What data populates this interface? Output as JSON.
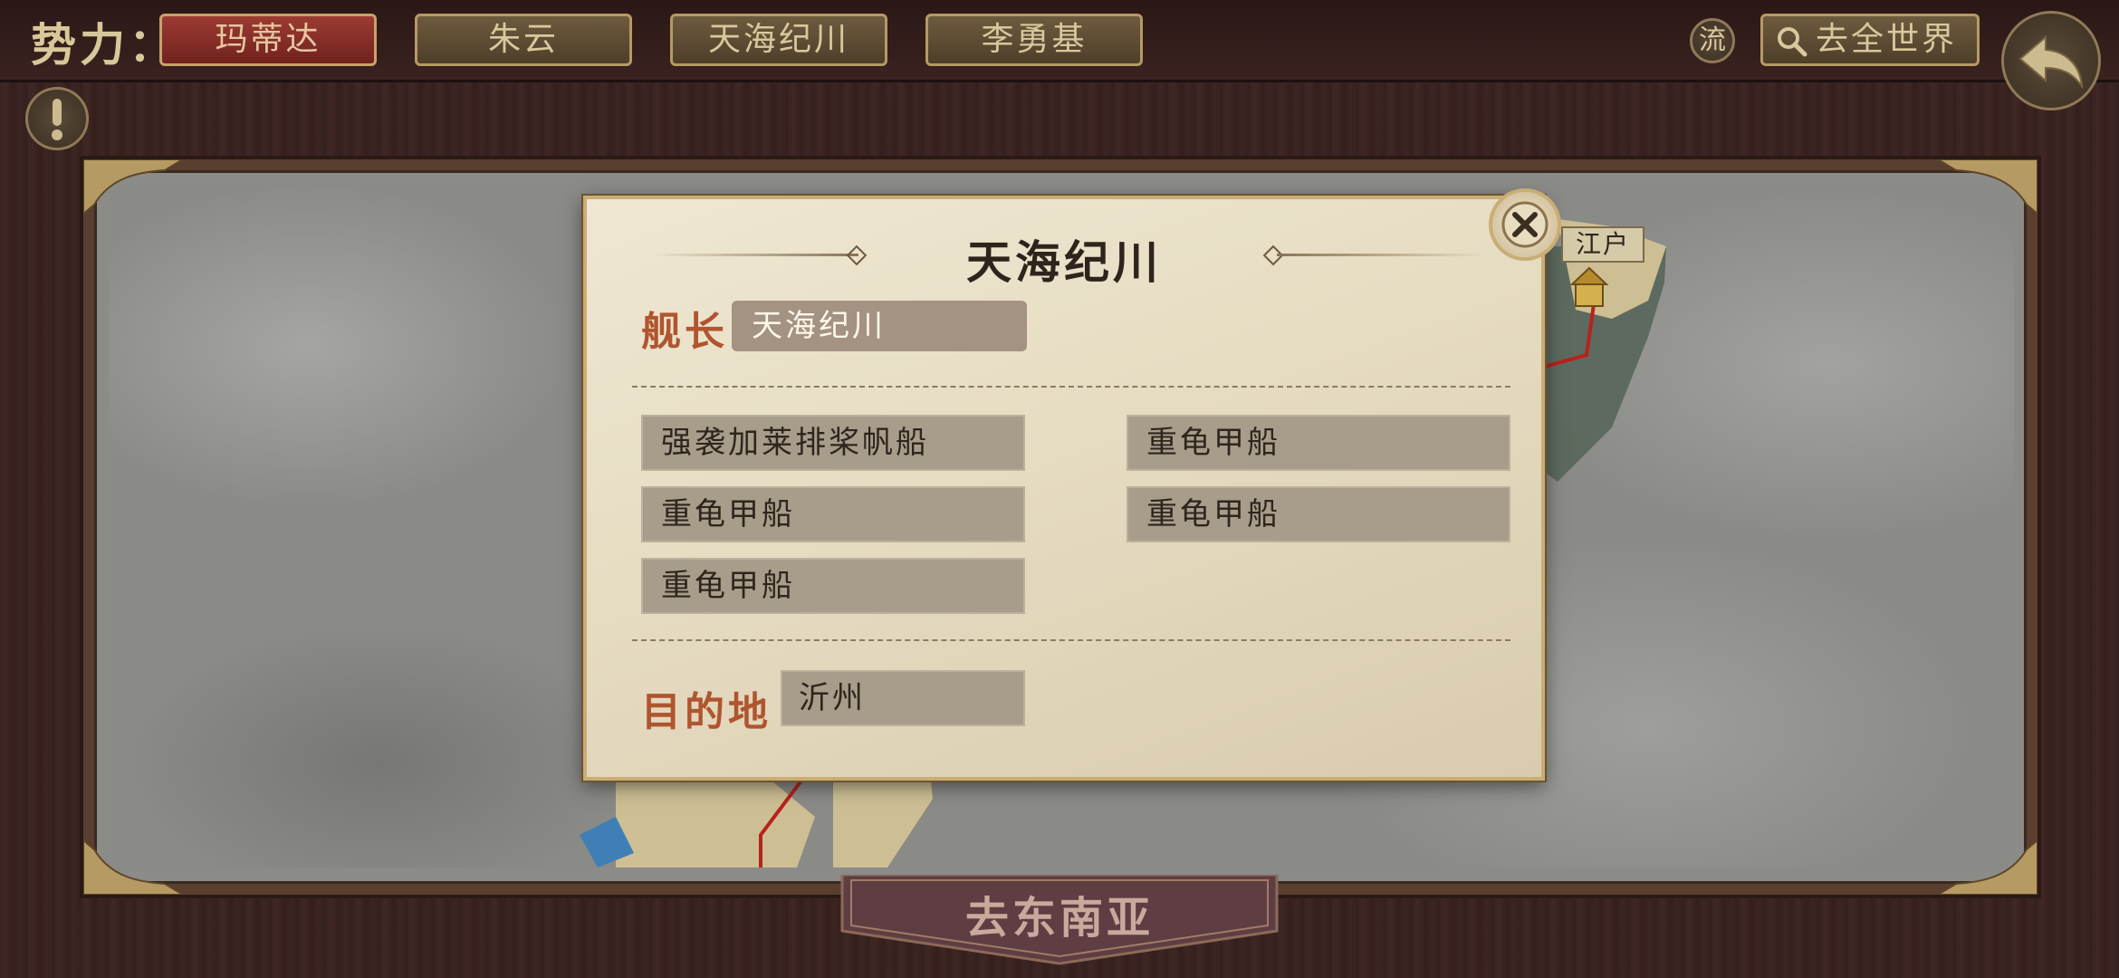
{
  "topbar": {
    "faction_label": "势力：",
    "tabs": [
      {
        "label": "玛蒂达",
        "active": true
      },
      {
        "label": "朱云",
        "active": false
      },
      {
        "label": "天海纪川",
        "active": false
      },
      {
        "label": "李勇基",
        "active": false
      }
    ],
    "flow_button": "流",
    "search_label": "去全世界"
  },
  "map": {
    "city_label": "江户"
  },
  "dialog": {
    "title": "天海纪川",
    "captain_label": "舰长",
    "captain_value": "天海纪川",
    "ships": [
      "强袭加莱排桨帆船",
      "重龟甲船",
      "重龟甲船",
      "重龟甲船",
      "重龟甲船"
    ],
    "destination_label": "目的地",
    "destination_value": "沂州"
  },
  "bottom_button": "去东南亚",
  "colors": {
    "active_tab": "#9c3b33",
    "label_red": "#b0552f",
    "route_red": "#b8221c"
  }
}
